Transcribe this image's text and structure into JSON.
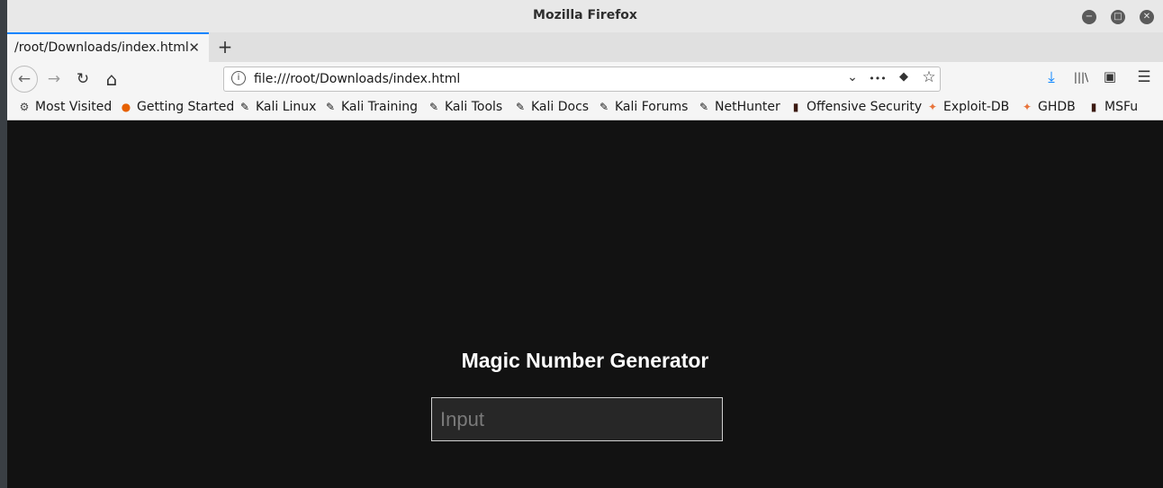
{
  "window": {
    "title": "Mozilla Firefox",
    "minimize_glyph": "−",
    "maximize_glyph": "□",
    "close_glyph": "✕"
  },
  "tabs": [
    {
      "label": "/root/Downloads/index.html",
      "close_glyph": "✕"
    }
  ],
  "new_tab_glyph": "+",
  "navbar": {
    "back_glyph": "←",
    "forward_glyph": "→",
    "reload_glyph": "↻",
    "home_glyph": "⌂",
    "url": "file:///root/Downloads/index.html",
    "info_glyph": "i",
    "dropdown_glyph": "⌄",
    "more_glyph": "•••",
    "pocket_glyph": "◆",
    "star_glyph": "☆",
    "download_glyph": "⤓",
    "library_glyph": "|||\\",
    "sidebar_glyph": "▣",
    "menu_glyph": "☰"
  },
  "bookmarks": [
    {
      "label": "Most Visited",
      "icon": "gear-icon",
      "glyph": "⚙"
    },
    {
      "label": "Getting Started",
      "icon": "firefox-icon",
      "glyph": "●"
    },
    {
      "label": "Kali Linux",
      "icon": "kali-dragon-icon",
      "glyph": "✎"
    },
    {
      "label": "Kali Training",
      "icon": "kali-dragon-icon",
      "glyph": "✎"
    },
    {
      "label": "Kali Tools",
      "icon": "kali-dragon-icon",
      "glyph": "✎"
    },
    {
      "label": "Kali Docs",
      "icon": "kali-dragon-icon",
      "glyph": "✎"
    },
    {
      "label": "Kali Forums",
      "icon": "kali-dragon-icon",
      "glyph": "✎"
    },
    {
      "label": "NetHunter",
      "icon": "kali-dragon-icon",
      "glyph": "✎"
    },
    {
      "label": "Offensive Security",
      "icon": "offsec-icon",
      "glyph": "▮"
    },
    {
      "label": "Exploit-DB",
      "icon": "exploitdb-icon",
      "glyph": "✦"
    },
    {
      "label": "GHDB",
      "icon": "ghdb-icon",
      "glyph": "✦"
    },
    {
      "label": "MSFu",
      "icon": "offsec-icon",
      "glyph": "▮"
    }
  ],
  "page": {
    "heading": "Magic Number Generator",
    "input_placeholder": "Input",
    "input_value": ""
  },
  "colors": {
    "accent": "#0a84ff",
    "page_background": "#121212",
    "firefox_orange": "#e66000",
    "exploitdb_orange": "#e8743b",
    "offsec_dark": "#3b1a12"
  }
}
